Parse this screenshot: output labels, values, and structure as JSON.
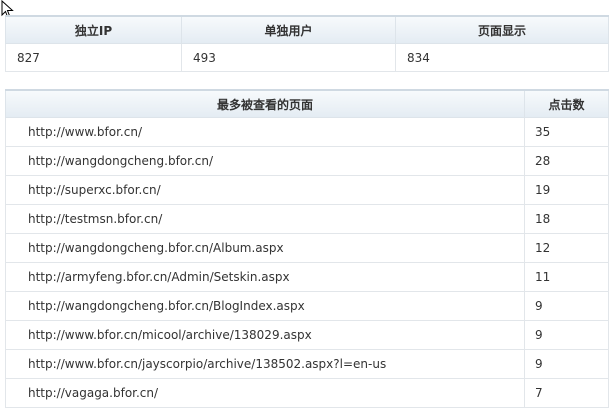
{
  "summary": {
    "headers": [
      "独立IP",
      "单独用户",
      "页面显示"
    ],
    "values": [
      "827",
      "493",
      "834"
    ]
  },
  "pages": {
    "headers": [
      "最多被查看的页面",
      "点击数"
    ],
    "rows": [
      {
        "url": "http://www.bfor.cn/",
        "count": "35"
      },
      {
        "url": "http://wangdongcheng.bfor.cn/",
        "count": "28"
      },
      {
        "url": "http://superxc.bfor.cn/",
        "count": "19"
      },
      {
        "url": "http://testmsn.bfor.cn/",
        "count": "18"
      },
      {
        "url": "http://wangdongcheng.bfor.cn/Album.aspx",
        "count": "12"
      },
      {
        "url": "http://armyfeng.bfor.cn/Admin/Setskin.aspx",
        "count": "11"
      },
      {
        "url": "http://wangdongcheng.bfor.cn/BlogIndex.aspx",
        "count": "9"
      },
      {
        "url": "http://www.bfor.cn/micool/archive/138029.aspx",
        "count": "9"
      },
      {
        "url": "http://www.bfor.cn/jayscorpio/archive/138502.aspx?l=en-us",
        "count": "9"
      },
      {
        "url": "http://vagaga.bfor.cn/",
        "count": "7"
      }
    ]
  },
  "icons": {
    "cursor": "mouse-pointer-icon"
  }
}
